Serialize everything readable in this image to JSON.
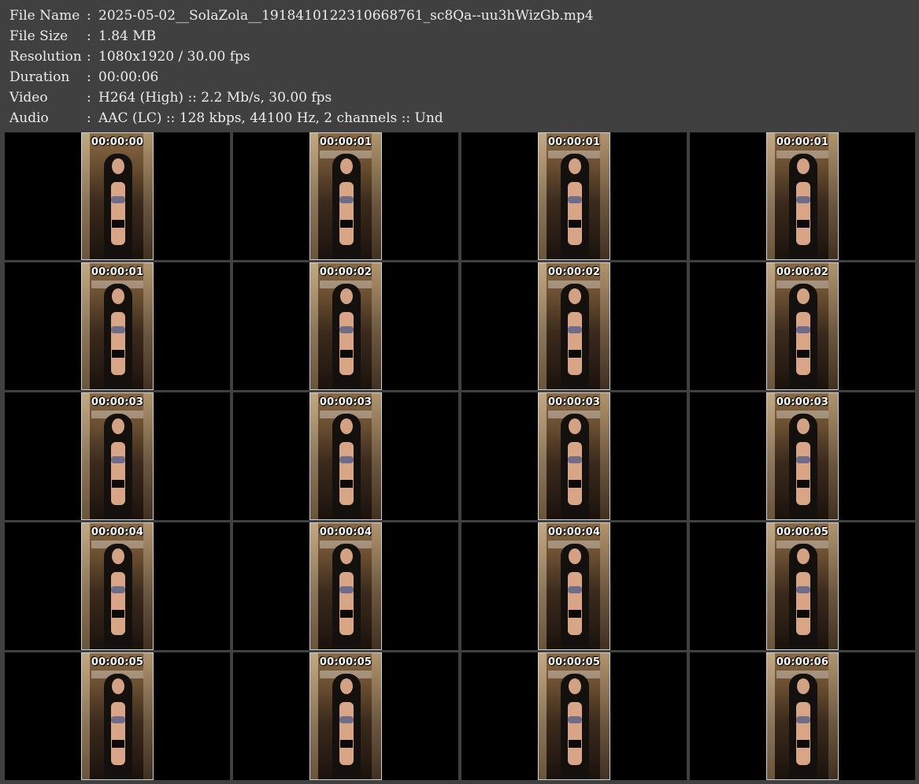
{
  "file_info": {
    "file_name_label": "File Name",
    "file_name": "2025-05-02__SolaZola__1918410122310668761_sc8Qa--uu3hWizGb.mp4",
    "file_size_label": "File Size",
    "file_size": "1.84 MB",
    "resolution_label": "Resolution",
    "resolution": "1080x1920 / 30.00 fps",
    "duration_label": "Duration",
    "duration": "00:00:06",
    "video_label": "Video",
    "video": "H264 (High) :: 2.2 Mb/s, 30.00 fps",
    "audio_label": "Audio",
    "audio": "AAC (LC) :: 128 kbps, 44100 Hz, 2 channels :: Und",
    "separator": ":"
  },
  "thumbnails": [
    {
      "timestamp": "00:00:00"
    },
    {
      "timestamp": "00:00:01"
    },
    {
      "timestamp": "00:00:01"
    },
    {
      "timestamp": "00:00:01"
    },
    {
      "timestamp": "00:00:01"
    },
    {
      "timestamp": "00:00:02"
    },
    {
      "timestamp": "00:00:02"
    },
    {
      "timestamp": "00:00:02"
    },
    {
      "timestamp": "00:00:03"
    },
    {
      "timestamp": "00:00:03"
    },
    {
      "timestamp": "00:00:03"
    },
    {
      "timestamp": "00:00:03"
    },
    {
      "timestamp": "00:00:04"
    },
    {
      "timestamp": "00:00:04"
    },
    {
      "timestamp": "00:00:04"
    },
    {
      "timestamp": "00:00:05"
    },
    {
      "timestamp": "00:00:05"
    },
    {
      "timestamp": "00:00:05"
    },
    {
      "timestamp": "00:00:05"
    },
    {
      "timestamp": "00:00:06"
    }
  ],
  "colors": {
    "background": "#404040",
    "text": "#ececec",
    "cell_background": "#000000",
    "timestamp_text": "#ffffff"
  }
}
